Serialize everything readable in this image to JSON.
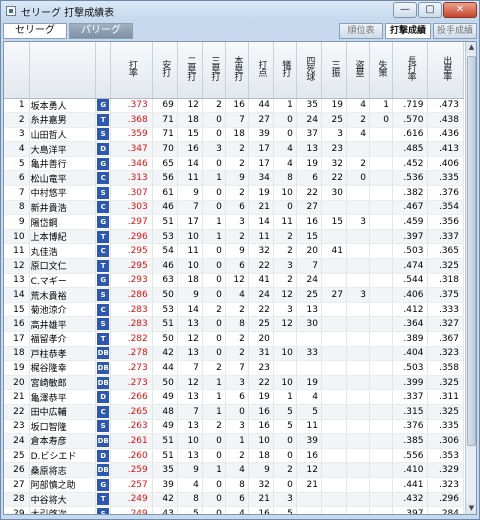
{
  "window": {
    "title": "セリーグ 打撃成績表",
    "minimize": "—",
    "maximize": "▢",
    "close": "✕"
  },
  "league_tabs": {
    "central": "セリーグ",
    "pacific": "パリーグ"
  },
  "toolbar": {
    "standings": "順位表",
    "batting": "打撃成績",
    "pitching": "投手成績"
  },
  "team_colors": {
    "default": "#2e57b0"
  },
  "columns": [
    "",
    "",
    "",
    "打率",
    "安打",
    "二塁打",
    "三塁打",
    "本塁打",
    "打点",
    "犠打",
    "四死球",
    "三振",
    "盗塁",
    "失策",
    "長打率",
    "出塁率"
  ],
  "rows": [
    {
      "rank": "1",
      "name": "坂本勇人",
      "team": "G",
      "avg": ".373",
      "h": "69",
      "d": "12",
      "t": "2",
      "hr": "16",
      "rbi": "44",
      "sac": "1",
      "bb": "35",
      "so": "19",
      "sb": "4",
      "e": "1",
      "slg": ".719",
      "obp": ".473"
    },
    {
      "rank": "2",
      "name": "糸井嘉男",
      "team": "T",
      "avg": ".368",
      "h": "71",
      "d": "18",
      "t": "0",
      "hr": "7",
      "rbi": "27",
      "sac": "0",
      "bb": "24",
      "so": "25",
      "sb": "2",
      "e": "0",
      "slg": ".570",
      "obp": ".438"
    },
    {
      "rank": "3",
      "name": "山田哲人",
      "team": "S",
      "avg": ".359",
      "h": "71",
      "d": "15",
      "t": "0",
      "hr": "18",
      "rbi": "39",
      "sac": "0",
      "bb": "37",
      "so": "3",
      "sb": "4",
      "e": "",
      "slg": ".616",
      "obp": ".436"
    },
    {
      "rank": "4",
      "name": "大島洋平",
      "team": "D",
      "avg": ".347",
      "h": "70",
      "d": "16",
      "t": "3",
      "hr": "2",
      "rbi": "17",
      "sac": "4",
      "bb": "13",
      "so": "23",
      "sb": "",
      "e": "",
      "slg": ".485",
      "obp": ".413"
    },
    {
      "rank": "5",
      "name": "亀井善行",
      "team": "G",
      "avg": ".346",
      "h": "65",
      "d": "14",
      "t": "0",
      "hr": "2",
      "rbi": "17",
      "sac": "4",
      "bb": "19",
      "so": "32",
      "sb": "2",
      "e": "",
      "slg": ".452",
      "obp": ".406"
    },
    {
      "rank": "6",
      "name": "松山竜平",
      "team": "C",
      "avg": ".313",
      "h": "56",
      "d": "11",
      "t": "1",
      "hr": "9",
      "rbi": "34",
      "sac": "8",
      "bb": "6",
      "so": "22",
      "sb": "0",
      "e": "",
      "slg": ".536",
      "obp": ".335"
    },
    {
      "rank": "7",
      "name": "中村悠平",
      "team": "S",
      "avg": ".307",
      "h": "61",
      "d": "9",
      "t": "0",
      "hr": "2",
      "rbi": "19",
      "sac": "10",
      "bb": "22",
      "so": "30",
      "sb": "",
      "e": "",
      "slg": ".382",
      "obp": ".376"
    },
    {
      "rank": "8",
      "name": "新井貴浩",
      "team": "C",
      "avg": ".303",
      "h": "46",
      "d": "7",
      "t": "0",
      "hr": "6",
      "rbi": "21",
      "sac": "0",
      "bb": "27",
      "so": "",
      "sb": "",
      "e": "",
      "slg": ".467",
      "obp": ".354"
    },
    {
      "rank": "9",
      "name": "陽岱鋼",
      "team": "G",
      "avg": ".297",
      "h": "51",
      "d": "17",
      "t": "1",
      "hr": "3",
      "rbi": "14",
      "sac": "11",
      "bb": "16",
      "so": "15",
      "sb": "3",
      "e": "",
      "slg": ".459",
      "obp": ".356"
    },
    {
      "rank": "10",
      "name": "上本博紀",
      "team": "T",
      "avg": ".296",
      "h": "53",
      "d": "10",
      "t": "1",
      "hr": "2",
      "rbi": "11",
      "sac": "2",
      "bb": "15",
      "so": "",
      "sb": "",
      "e": "",
      "slg": ".397",
      "obp": ".337"
    },
    {
      "rank": "11",
      "name": "丸佳浩",
      "team": "C",
      "avg": ".295",
      "h": "54",
      "d": "11",
      "t": "0",
      "hr": "9",
      "rbi": "32",
      "sac": "2",
      "bb": "20",
      "so": "41",
      "sb": "",
      "e": "",
      "slg": ".503",
      "obp": ".365"
    },
    {
      "rank": "12",
      "name": "原口文仁",
      "team": "T",
      "avg": ".295",
      "h": "46",
      "d": "10",
      "t": "0",
      "hr": "6",
      "rbi": "22",
      "sac": "3",
      "bb": "7",
      "so": "",
      "sb": "",
      "e": "",
      "slg": ".474",
      "obp": ".325"
    },
    {
      "rank": "13",
      "name": "C.マギー",
      "team": "G",
      "avg": ".293",
      "h": "63",
      "d": "18",
      "t": "0",
      "hr": "12",
      "rbi": "41",
      "sac": "2",
      "bb": "24",
      "so": "",
      "sb": "",
      "e": "",
      "slg": ".544",
      "obp": ".318"
    },
    {
      "rank": "14",
      "name": "荒木貴裕",
      "team": "S",
      "avg": ".286",
      "h": "50",
      "d": "9",
      "t": "0",
      "hr": "4",
      "rbi": "24",
      "sac": "12",
      "bb": "25",
      "so": "27",
      "sb": "3",
      "e": "",
      "slg": ".406",
      "obp": ".375"
    },
    {
      "rank": "15",
      "name": "菊池涼介",
      "team": "C",
      "avg": ".283",
      "h": "53",
      "d": "14",
      "t": "2",
      "hr": "2",
      "rbi": "22",
      "sac": "3",
      "bb": "13",
      "so": "",
      "sb": "",
      "e": "",
      "slg": ".412",
      "obp": ".333"
    },
    {
      "rank": "16",
      "name": "高井雄平",
      "team": "S",
      "avg": ".283",
      "h": "51",
      "d": "13",
      "t": "0",
      "hr": "8",
      "rbi": "25",
      "sac": "12",
      "bb": "30",
      "so": "",
      "sb": "",
      "e": "",
      "slg": ".364",
      "obp": ".327"
    },
    {
      "rank": "17",
      "name": "福留孝介",
      "team": "T",
      "avg": ".282",
      "h": "50",
      "d": "12",
      "t": "0",
      "hr": "2",
      "rbi": "20",
      "sac": "",
      "bb": "",
      "so": "",
      "sb": "",
      "e": "",
      "slg": ".389",
      "obp": ".367"
    },
    {
      "rank": "18",
      "name": "戸柱恭孝",
      "team": "DB",
      "avg": ".278",
      "h": "42",
      "d": "13",
      "t": "0",
      "hr": "2",
      "rbi": "31",
      "sac": "10",
      "bb": "33",
      "so": "",
      "sb": "",
      "e": "",
      "slg": ".404",
      "obp": ".323"
    },
    {
      "rank": "19",
      "name": "梶谷隆幸",
      "team": "DB",
      "avg": ".273",
      "h": "44",
      "d": "7",
      "t": "2",
      "hr": "7",
      "rbi": "23",
      "sac": "",
      "bb": "",
      "so": "",
      "sb": "",
      "e": "",
      "slg": ".503",
      "obp": ".358"
    },
    {
      "rank": "20",
      "name": "宮崎敏郎",
      "team": "DB",
      "avg": ".273",
      "h": "50",
      "d": "12",
      "t": "1",
      "hr": "3",
      "rbi": "22",
      "sac": "10",
      "bb": "19",
      "so": "",
      "sb": "",
      "e": "",
      "slg": ".399",
      "obp": ".325"
    },
    {
      "rank": "21",
      "name": "亀澤恭平",
      "team": "D",
      "avg": ".266",
      "h": "49",
      "d": "13",
      "t": "1",
      "hr": "6",
      "rbi": "19",
      "sac": "1",
      "bb": "4",
      "so": "",
      "sb": "",
      "e": "",
      "slg": ".337",
      "obp": ".311"
    },
    {
      "rank": "22",
      "name": "田中広輔",
      "team": "C",
      "avg": ".265",
      "h": "48",
      "d": "7",
      "t": "1",
      "hr": "0",
      "rbi": "16",
      "sac": "5",
      "bb": "5",
      "so": "",
      "sb": "",
      "e": "",
      "slg": ".315",
      "obp": ".325"
    },
    {
      "rank": "23",
      "name": "坂口智隆",
      "team": "S",
      "avg": ".263",
      "h": "49",
      "d": "13",
      "t": "2",
      "hr": "3",
      "rbi": "16",
      "sac": "5",
      "bb": "11",
      "so": "",
      "sb": "",
      "e": "",
      "slg": ".376",
      "obp": ".335"
    },
    {
      "rank": "24",
      "name": "倉本寿彦",
      "team": "DB",
      "avg": ".261",
      "h": "51",
      "d": "10",
      "t": "0",
      "hr": "1",
      "rbi": "10",
      "sac": "0",
      "bb": "39",
      "so": "",
      "sb": "",
      "e": "",
      "slg": ".385",
      "obp": ".306"
    },
    {
      "rank": "25",
      "name": "D.ビシエド",
      "team": "D",
      "avg": ".260",
      "h": "51",
      "d": "13",
      "t": "0",
      "hr": "2",
      "rbi": "18",
      "sac": "0",
      "bb": "16",
      "so": "",
      "sb": "",
      "e": "",
      "slg": ".556",
      "obp": ".353"
    },
    {
      "rank": "26",
      "name": "桑原将志",
      "team": "DB",
      "avg": ".259",
      "h": "35",
      "d": "9",
      "t": "1",
      "hr": "4",
      "rbi": "9",
      "sac": "2",
      "bb": "12",
      "so": "",
      "sb": "",
      "e": "",
      "slg": ".410",
      "obp": ".329"
    },
    {
      "rank": "27",
      "name": "阿部慎之助",
      "team": "G",
      "avg": ".257",
      "h": "39",
      "d": "4",
      "t": "0",
      "hr": "8",
      "rbi": "32",
      "sac": "0",
      "bb": "21",
      "so": "",
      "sb": "",
      "e": "",
      "slg": ".441",
      "obp": ".323"
    },
    {
      "rank": "28",
      "name": "中谷将大",
      "team": "T",
      "avg": ".249",
      "h": "42",
      "d": "8",
      "t": "0",
      "hr": "6",
      "rbi": "21",
      "sac": "3",
      "bb": "",
      "so": "",
      "sb": "",
      "e": "",
      "slg": ".432",
      "obp": ".296"
    },
    {
      "rank": "29",
      "name": "大引啓次",
      "team": "S",
      "avg": ".249",
      "h": "43",
      "d": "5",
      "t": "0",
      "hr": "4",
      "rbi": "16",
      "sac": "5",
      "bb": "",
      "so": "",
      "sb": "",
      "e": "",
      "slg": ".397",
      "obp": ".284"
    },
    {
      "rank": "30",
      "name": "鳥谷敬",
      "team": "T",
      "avg": ".238",
      "h": "44",
      "d": "",
      "t": "",
      "hr": "",
      "rbi": "",
      "sac": "",
      "bb": "",
      "so": "",
      "sb": "",
      "e": "",
      "slg": ".368",
      "obp": ".284"
    }
  ]
}
